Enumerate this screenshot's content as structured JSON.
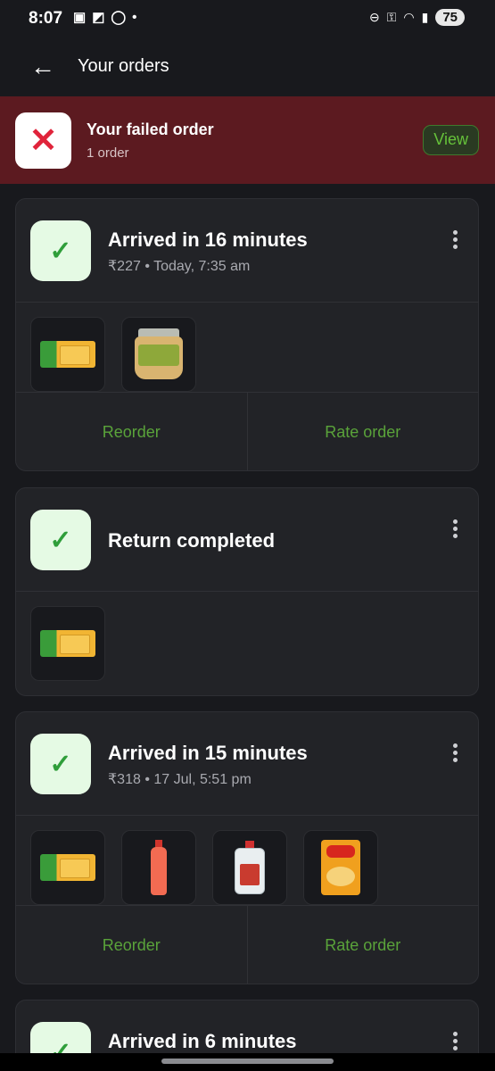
{
  "status_bar": {
    "time": "8:07",
    "battery": "75"
  },
  "header": {
    "title": "Your orders"
  },
  "failed_banner": {
    "title": "Your failed order",
    "subtitle": "1 order",
    "view_label": "View"
  },
  "orders": [
    {
      "title": "Arrived in 16 minutes",
      "meta": "₹227 • Today, 7:35 am",
      "items": [
        "biscuit-pack",
        "sauce-jar"
      ],
      "reorder_label": "Reorder",
      "rate_label": "Rate order"
    },
    {
      "title": "Return completed",
      "items": [
        "biscuit-pack"
      ]
    },
    {
      "title": "Arrived in 15 minutes",
      "meta": "₹318 • 17 Jul, 5:51 pm",
      "items": [
        "biscuit-pack",
        "juice-bottle",
        "oil-can",
        "snack-pack"
      ],
      "reorder_label": "Reorder",
      "rate_label": "Rate order"
    },
    {
      "title": "Arrived in 6 minutes"
    }
  ],
  "colors": {
    "background": "#18191d",
    "card": "#222327",
    "failed_banner": "#5c1a20",
    "accent_green": "#5aa33a",
    "error_red": "#e0243b"
  }
}
